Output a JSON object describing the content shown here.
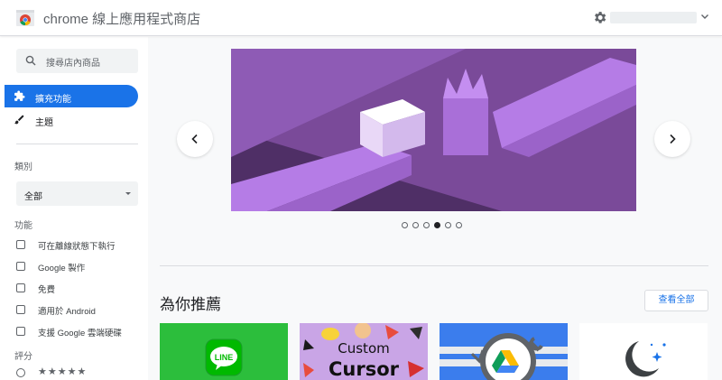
{
  "header": {
    "title": "chrome 線上應用程式商店",
    "logo_icon": "chrome-web-store-icon",
    "settings_icon": "gear-icon",
    "account_chevron_icon": "chevron-down-icon"
  },
  "sidebar": {
    "search_placeholder": "搜尋店內商品",
    "nav": [
      {
        "label": "擴充功能",
        "icon": "puzzle-icon",
        "active": true
      },
      {
        "label": "主題",
        "icon": "brush-icon",
        "active": false
      }
    ],
    "category_label": "類別",
    "category_value": "全部",
    "features_label": "功能",
    "features": [
      "可在離線狀態下執行",
      "Google 製作",
      "免費",
      "適用於 Android",
      "支援 Google 雲端硬碟"
    ],
    "rating_label": "評分",
    "rating_stars": "★★★★★"
  },
  "main": {
    "carousel": {
      "prev_icon": "chevron-left-icon",
      "next_icon": "chevron-right-icon",
      "slide_count": 6,
      "active_slide": 4,
      "colors": {
        "dark": "#4a2a5c",
        "mid": "#8e5bb5",
        "light": "#b579e0",
        "white_cube": "#f3e8ff"
      }
    },
    "recommended": {
      "title": "為你推薦",
      "view_all": "查看全部",
      "tiles": [
        {
          "name": "LINE",
          "logo_text": "LINE",
          "bg": "#2cbe3c"
        },
        {
          "name": "Custom Cursor",
          "line1": "Custom",
          "line2": "Cursor",
          "bg": "#c9a5e6"
        },
        {
          "name": "Google Drive extension",
          "bg": "#3b7ded"
        },
        {
          "name": "Night mode extension",
          "bg": "#ffffff"
        }
      ]
    }
  },
  "colors": {
    "accent": "#1a73e8",
    "text": "#202124",
    "muted": "#5f6368"
  }
}
